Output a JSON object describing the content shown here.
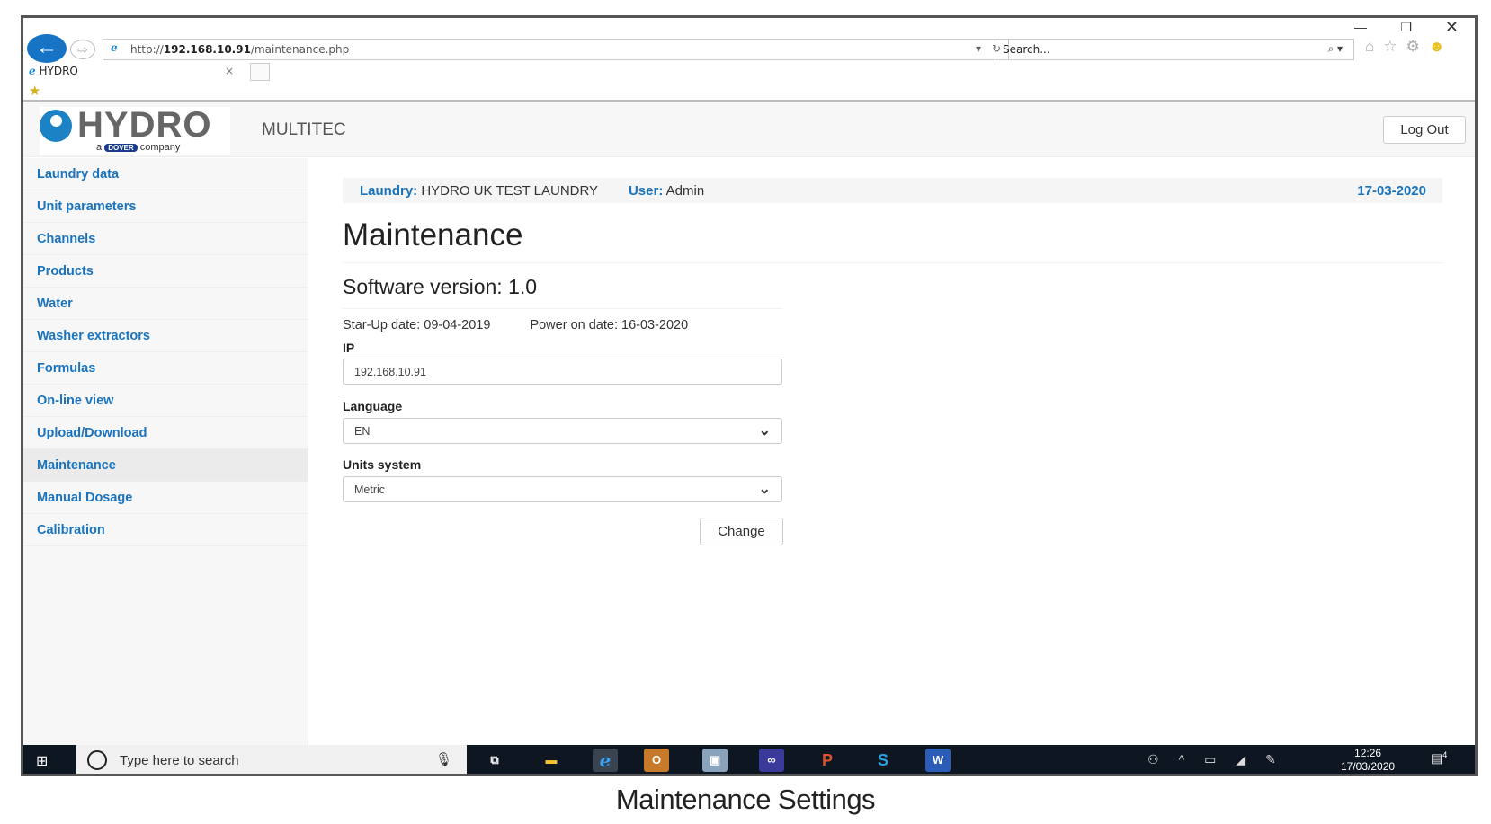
{
  "browser": {
    "url_prefix": "http://",
    "url_host": "192.168.10.91",
    "url_path": "/maintenance.php",
    "search_placeholder": "Search...",
    "tab_title": "HYDRO",
    "tab_close": "×"
  },
  "header": {
    "brand": "HYDRO",
    "brand_sub_a": "a",
    "brand_sub_dover": "DOVER",
    "brand_sub_company": "company",
    "product": "MULTITEC",
    "logout": "Log Out"
  },
  "sidebar": {
    "items": [
      {
        "label": "Laundry data"
      },
      {
        "label": "Unit parameters"
      },
      {
        "label": "Channels"
      },
      {
        "label": "Products"
      },
      {
        "label": "Water"
      },
      {
        "label": "Washer extractors"
      },
      {
        "label": "Formulas"
      },
      {
        "label": "On-line view"
      },
      {
        "label": "Upload/Download"
      },
      {
        "label": "Maintenance",
        "active": true
      },
      {
        "label": "Manual Dosage"
      },
      {
        "label": "Calibration"
      }
    ]
  },
  "info": {
    "laundry_label": "Laundry:",
    "laundry": "HYDRO UK TEST LAUNDRY",
    "user_label": "User:",
    "user": "Admin",
    "date": "17-03-2020"
  },
  "page": {
    "title": "Maintenance",
    "software": "Software version: 1.0",
    "startup": "Star-Up date: 09-04-2019",
    "poweron": "Power on date: 16-03-2020",
    "ip_label": "IP",
    "ip_value": "192.168.10.91",
    "language_label": "Language",
    "language_value": "EN",
    "units_label": "Units system",
    "units_value": "Metric",
    "change": "Change"
  },
  "taskbar": {
    "search_placeholder": "Type here to search",
    "time": "12:26",
    "date": "17/03/2020",
    "notifications": "4"
  },
  "caption": "Maintenance Settings",
  "colors": {
    "accent": "#1a74bd",
    "taskbar": "#0e1621"
  }
}
